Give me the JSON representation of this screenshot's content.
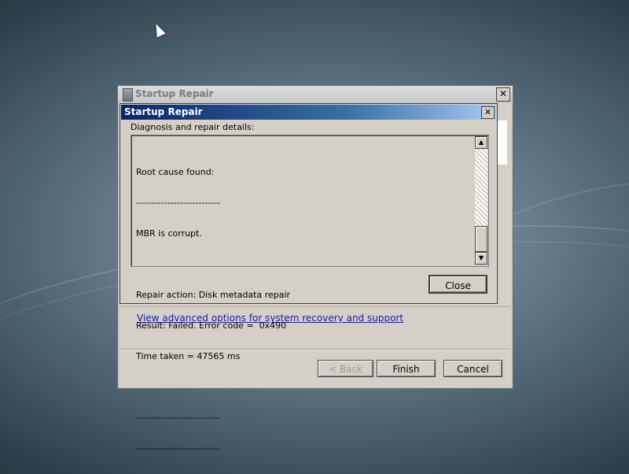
{
  "main_window": {
    "title": "Startup Repair",
    "close_glyph": "✕",
    "link_text": "View advanced options for system recovery and support",
    "buttons": {
      "back": "< Back",
      "finish": "Finish",
      "cancel": "Cancel"
    }
  },
  "dialog": {
    "title": "Startup Repair",
    "close_glyph": "✕",
    "details_label": "Diagnosis and repair details:",
    "details_lines": [
      "Root cause found:",
      "---------------------------",
      "MBR is corrupt.",
      "",
      "Repair action: Disk metadata repair",
      "Result: Failed. Error code =  0x490",
      "Time taken = 47565 ms",
      "",
      "---------------------------",
      "---------------------------"
    ],
    "close_button": "Close",
    "scroll": {
      "up": "▲",
      "down": "▼"
    }
  },
  "icons": {
    "app": "startup-repair-icon",
    "cursor": "mouse-pointer-icon"
  }
}
